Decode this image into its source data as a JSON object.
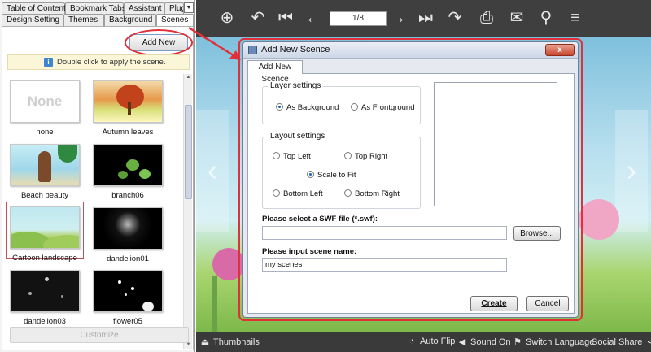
{
  "left_panel": {
    "tabs_row1": [
      "Table of Contents",
      "Bookmark Tabs",
      "Assistant",
      "Plugin"
    ],
    "tabs_row2": [
      "Design Setting",
      "Themes",
      "Background",
      "Scenes"
    ],
    "active_tab": "Scenes",
    "add_new_label": "Add New",
    "hint": "Double click to apply the scene.",
    "scenes": [
      {
        "label": "none",
        "thumb_text": "None"
      },
      {
        "label": "Autumn leaves"
      },
      {
        "label": "Beach beauty"
      },
      {
        "label": "branch06"
      },
      {
        "label": "Cartoon landscape",
        "selected": true
      },
      {
        "label": "dandelion01"
      },
      {
        "label": "dandelion03"
      },
      {
        "label": "flower05"
      }
    ],
    "customize_label": "Customize"
  },
  "viewer": {
    "page_indicator": "1/8",
    "toolbar_icons": [
      "zoom-in-icon",
      "back-icon",
      "first-page-icon",
      "prev-page-icon",
      "next-page-icon",
      "last-page-icon",
      "forward-icon",
      "print-icon",
      "email-icon",
      "search-icon",
      "menu-icon"
    ],
    "bottom_bar": {
      "thumbnails": "Thumbnails",
      "auto_flip": "Auto Flip",
      "sound_on": "Sound On",
      "switch_language": "Switch Language",
      "social_share": "Social Share"
    }
  },
  "dialog": {
    "title": "Add New Scence",
    "close_label": "x",
    "tab_label": "Add New Scence",
    "layer_settings": {
      "title": "Layer settings",
      "options": [
        "As Background",
        "As Frontground"
      ],
      "selected": "As Background"
    },
    "layout_settings": {
      "title": "Layout settings",
      "options": [
        "Top Left",
        "Top Right",
        "Scale to Fit",
        "Bottom Left",
        "Bottom Right"
      ],
      "selected": "Scale to Fit"
    },
    "swf_label": "Please select a SWF file (*.swf):",
    "swf_value": "",
    "browse_label": "Browse...",
    "name_label": "Please input scene name:",
    "name_value": "my scenes",
    "create_label": "Create",
    "cancel_label": "Cancel"
  },
  "colors": {
    "annotation_red": "#e0303a",
    "toolbar_bg": "#3f3f3f",
    "selection_blue": "#1f5fb4"
  }
}
